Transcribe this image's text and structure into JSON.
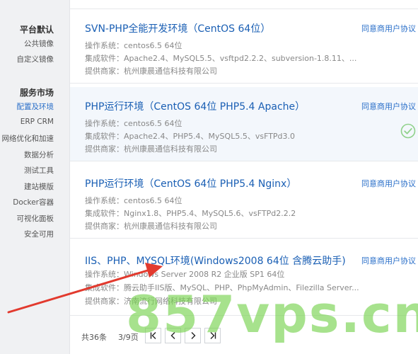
{
  "sidebar": {
    "group1_title": "平台默认",
    "group1_items": [
      "公共镜像",
      "自定义镜像"
    ],
    "group2_title": "服务市场",
    "group2_items": [
      "配置及环境",
      "ERP CRM",
      "网络优化和加速",
      "数据分析",
      "测试工具",
      "建站模版",
      "Docker容器",
      "可视化面板",
      "安全可用"
    ],
    "active_item": "配置及环境"
  },
  "cards": [
    {
      "title": "SVN-PHP全能开发环境（CentOS 64位）",
      "agree": "同意商用户协议",
      "os": "操作系统：centos6.5 64位",
      "software": "集成软件：Apache2.4、MySQL5.5、vsftpd2.2.2、subversion-1.8.11、...",
      "vendor": "提供商家：杭州康晨通信科技有限公司"
    },
    {
      "title": "PHP运行环境（CentOS 64位 PHP5.4 Apache）",
      "agree": "同意商用户协议",
      "os": "操作系统：centos6.5 64位",
      "software": "集成软件：Apache2.4、PHP5.4、MySQL5.5、vsFTPd3.0",
      "vendor": "提供商家：杭州康晨通信科技有限公司",
      "selected": true
    },
    {
      "title": "PHP运行环境（CentOS 64位 PHP5.4 Nginx）",
      "agree": "同意商用户协议",
      "os": "操作系统：centos6.5 64位",
      "software": "集成软件：Nginx1.8、PHP5.4、MySQL5.6、vsFTPd2.2.2",
      "vendor": "提供商家：杭州康晨通信科技有限公司"
    },
    {
      "title": "IIS、PHP、MYSQL环境(Windows2008 64位 含腾云助手)",
      "agree": "同意商用户协议",
      "os": "操作系统：Windows Server 2008 R2 企业版 SP1 64位",
      "software": "集成软件：腾云助手IIS版、MySQL、PHP、PhpMyAdmin、Filezilla Server...",
      "vendor": "提供商家：济南流行网络科技有限公司"
    }
  ],
  "pager": {
    "total": "共36条",
    "page": "3/9页"
  },
  "icons": {
    "first": "first-page-icon",
    "prev": "prev-page-icon",
    "next": "next-page-icon",
    "last": "last-page-icon",
    "check": "check-circle-icon"
  },
  "colors": {
    "link": "#1a5fb4",
    "check": "#8fd18a",
    "arrow": "#e23a2e",
    "watermark": "#78d250"
  },
  "watermark": "857vps.cn"
}
